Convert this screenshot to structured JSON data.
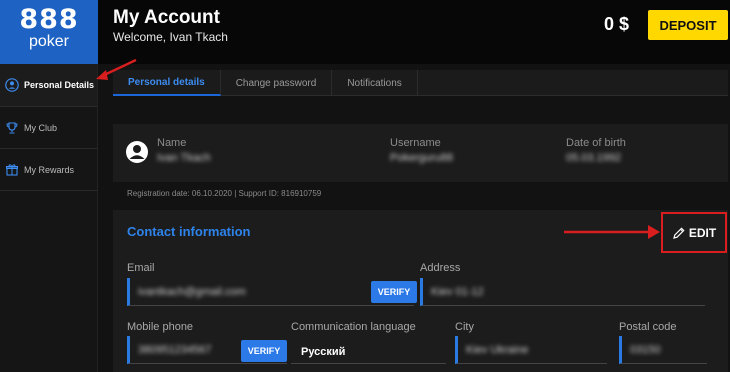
{
  "brand": {
    "logo_number": "888",
    "logo_word": "poker"
  },
  "header": {
    "title": "My Account",
    "welcome": "Welcome, Ivan Tkach",
    "balance": "0 $",
    "deposit_label": "DEPOSIT"
  },
  "sidebar": {
    "items": [
      {
        "label": "Personal Details",
        "icon": "user-icon",
        "active": true
      },
      {
        "label": "My Club",
        "icon": "trophy-icon",
        "active": false
      },
      {
        "label": "My Rewards",
        "icon": "gift-icon",
        "active": false
      }
    ]
  },
  "tabs": [
    {
      "label": "Personal details",
      "active": true
    },
    {
      "label": "Change password",
      "active": false
    },
    {
      "label": "Notifications",
      "active": false
    }
  ],
  "profile": {
    "name_label": "Name",
    "name_value": "Ivan Tkach",
    "username_label": "Username",
    "username_value": "Pokerguru88",
    "dob_label": "Date of birth",
    "dob_value": "05.03.1992"
  },
  "registration": "Registration date: 06.10.2020  |  Support ID: 816910759",
  "contact": {
    "title": "Contact information",
    "edit_label": "EDIT",
    "email_label": "Email",
    "email_value": "ivantkach@gmail.com",
    "verify_label": "VERIFY",
    "address_label": "Address",
    "address_value": "Kiev 01-12",
    "mobile_label": "Mobile phone",
    "mobile_value": "380951234567",
    "language_label": "Communication language",
    "language_value": "Русский",
    "city_label": "City",
    "city_value": "Kiev Ukraine",
    "postal_label": "Postal code",
    "postal_value": "03150"
  },
  "colors": {
    "accent": "#2b7ae8",
    "brand": "#1e63c4",
    "deposit": "#ffd800",
    "annotation": "#d81e1e"
  }
}
